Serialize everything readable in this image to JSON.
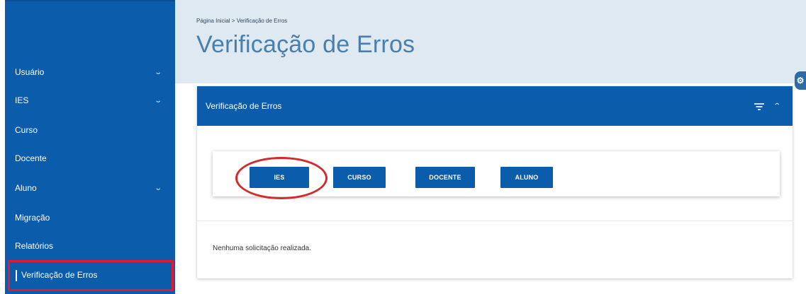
{
  "sidebar": {
    "items": [
      {
        "label": "Usuário",
        "expandable": true
      },
      {
        "label": "IES",
        "expandable": true
      },
      {
        "label": "Curso",
        "expandable": false
      },
      {
        "label": "Docente",
        "expandable": false
      },
      {
        "label": "Aluno",
        "expandable": true
      },
      {
        "label": "Migração",
        "expandable": false
      },
      {
        "label": "Relatórios",
        "expandable": false
      },
      {
        "label": "Verificação de Erros",
        "expandable": false,
        "active": true
      }
    ]
  },
  "header": {
    "breadcrumb": "Página Inicial > Verificação de Erros",
    "title": "Verificação de Erros"
  },
  "panel": {
    "title": "Verificação de Erros",
    "buttons": [
      {
        "label": "IES",
        "highlighted": true
      },
      {
        "label": "CURSO"
      },
      {
        "label": "DOCENTE"
      },
      {
        "label": "ALUNO"
      }
    ],
    "empty_message": "Nenhuma solicitação realizada."
  },
  "colors": {
    "primary": "#0b5cab",
    "header_bg": "#dfe9f2",
    "title_text": "#4a7fab",
    "annotation_red": "#d42a2a"
  }
}
